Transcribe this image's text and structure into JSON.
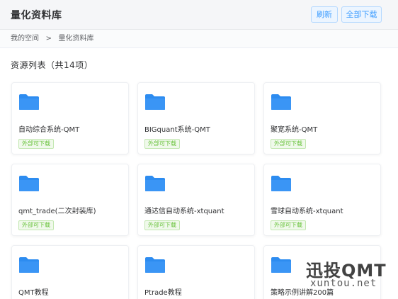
{
  "header": {
    "title": "量化资料库",
    "refresh_label": "刷新",
    "download_all_label": "全部下载"
  },
  "breadcrumb": {
    "root": "我的空间",
    "separator": ">",
    "current": "量化资料库"
  },
  "resource_list": {
    "title": "资源列表（共14项）",
    "items": [
      {
        "name": "自动综合系统-QMT",
        "badge": "外部可下载",
        "icon": "folder-icon"
      },
      {
        "name": "BIGquant系统-QMT",
        "badge": "外部可下载",
        "icon": "folder-icon"
      },
      {
        "name": "聚宽系统-QMT",
        "badge": "外部可下载",
        "icon": "folder-icon"
      },
      {
        "name": "qmt_trade(二次封装库)",
        "badge": "外部可下载",
        "icon": "folder-icon"
      },
      {
        "name": "通达信自动系统-xtquant",
        "badge": "外部可下载",
        "icon": "folder-icon"
      },
      {
        "name": "雪球自动系统-xtquant",
        "badge": "外部可下载",
        "icon": "folder-icon"
      },
      {
        "name": "QMT教程",
        "icon": "folder-icon"
      },
      {
        "name": "Ptrade教程",
        "icon": "folder-icon"
      },
      {
        "name": "策略示例讲解200篇",
        "icon": "folder-icon"
      }
    ]
  },
  "watermark": {
    "main": "迅投QMT",
    "sub": "xuntou.net"
  },
  "colors": {
    "folder": "#2d8cf0",
    "accent": "#409eff",
    "badge_text": "#67c23a"
  }
}
